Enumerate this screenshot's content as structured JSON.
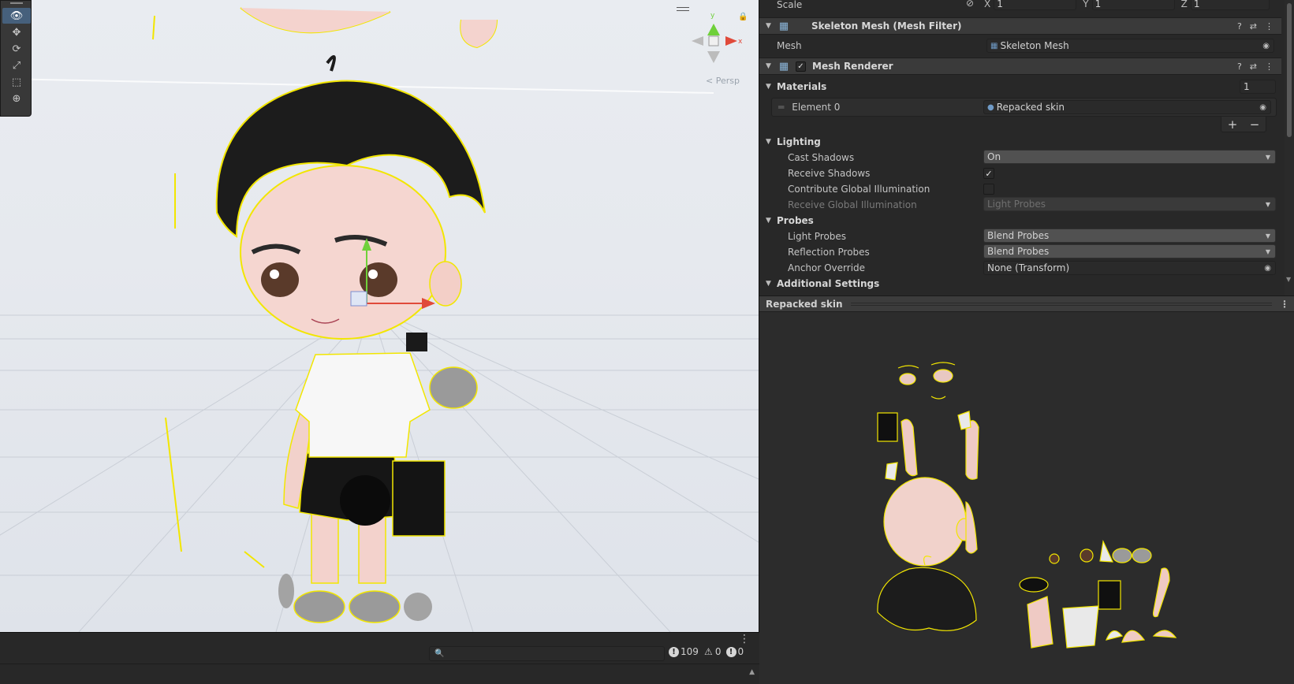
{
  "scene": {
    "tools": [
      {
        "name": "view-tool-icon",
        "glyph": "👁"
      },
      {
        "name": "move-tool-icon",
        "glyph": "✥"
      },
      {
        "name": "rotate-tool-icon",
        "glyph": "⟳"
      },
      {
        "name": "scale-tool-icon",
        "glyph": "⤢"
      },
      {
        "name": "rect-tool-icon",
        "glyph": "⬚"
      },
      {
        "name": "transform-tool-icon",
        "glyph": "⊕"
      }
    ],
    "gizmo_label": "< Persp",
    "lock_glyph": "🔒"
  },
  "console": {
    "menu_glyph": "⋮",
    "search_glyph": "🔍",
    "log_count": "109",
    "warning_count": "0",
    "error_count": "0"
  },
  "inspector": {
    "transform": {
      "scale_label": "Scale",
      "x_label": "X",
      "x_value": "1",
      "y_label": "Y",
      "y_value": "1",
      "z_label": "Z",
      "z_value": "1"
    },
    "mesh_filter": {
      "title": "Skeleton Mesh (Mesh Filter)",
      "mesh_label": "Mesh",
      "mesh_value": "Skeleton Mesh"
    },
    "mesh_renderer": {
      "title": "Mesh Renderer",
      "materials_label": "Materials",
      "materials_count": "1",
      "element0_label": "Element 0",
      "element0_value": "Repacked skin",
      "plus": "+",
      "minus": "−",
      "lighting_label": "Lighting",
      "cast_shadows_label": "Cast Shadows",
      "cast_shadows_value": "On",
      "receive_shadows_label": "Receive Shadows",
      "contribute_gi_label": "Contribute Global Illumination",
      "receive_gi_label": "Receive Global Illumination",
      "receive_gi_value": "Light Probes",
      "probes_label": "Probes",
      "light_probes_label": "Light Probes",
      "light_probes_value": "Blend Probes",
      "reflection_probes_label": "Reflection Probes",
      "reflection_probes_value": "Blend Probes",
      "anchor_override_label": "Anchor Override",
      "anchor_override_value": "None (Transform)",
      "additional_settings_label": "Additional Settings"
    }
  },
  "preview": {
    "title": "Repacked skin"
  },
  "colors": {
    "panel_bg": "#282828",
    "header_bg": "#3a3a3a",
    "outline_yellow": "#f2e600",
    "active_tool": "#46607c"
  }
}
